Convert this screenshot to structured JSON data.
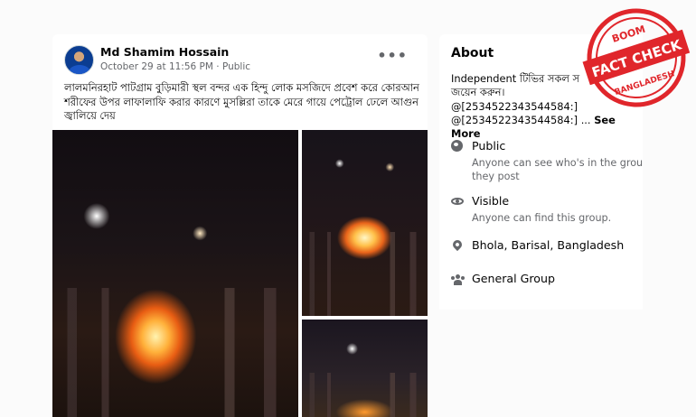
{
  "post": {
    "author": "Md Shamim Hossain",
    "date": "October 29 at 11:56 PM",
    "separator": " · ",
    "privacy": "Public",
    "more": "•••",
    "text": "লালমনিরহাট পাটগ্রাম বুড়িমারী স্থল বন্দর এক হিন্দু লোক মসজিদে প্রবেশ করে কোরআন শরীফের উপর লাফালাফি করার কারণে মুসল্লিরা তাকে মেরে গায়ে পেট্রোল ঢেলে আগুন জ্বালিয়ে দেয়"
  },
  "about": {
    "title": "About",
    "desc_line1": "Independent টিভির সকল স",
    "desc_line2": "জয়েন করুন।",
    "desc_line3": "@[2534522343544584:]",
    "desc_line4": "@[2534522343544584:] ...",
    "see_more": "See More",
    "public_label": "Public",
    "public_sub": "Anyone can see who's in the grou they post",
    "visible_label": "Visible",
    "visible_sub": "Anyone can find this group.",
    "location": "Bhola, Barisal, Bangladesh",
    "group_type": "General Group"
  },
  "stamp": {
    "brand": "BOOM",
    "main": "FACT CHECK",
    "country": "BANGLADESH",
    "color": "#e0262b"
  },
  "icons": [
    "globe-icon",
    "eye-icon",
    "location-pin-icon",
    "group-icon",
    "more-icon"
  ]
}
